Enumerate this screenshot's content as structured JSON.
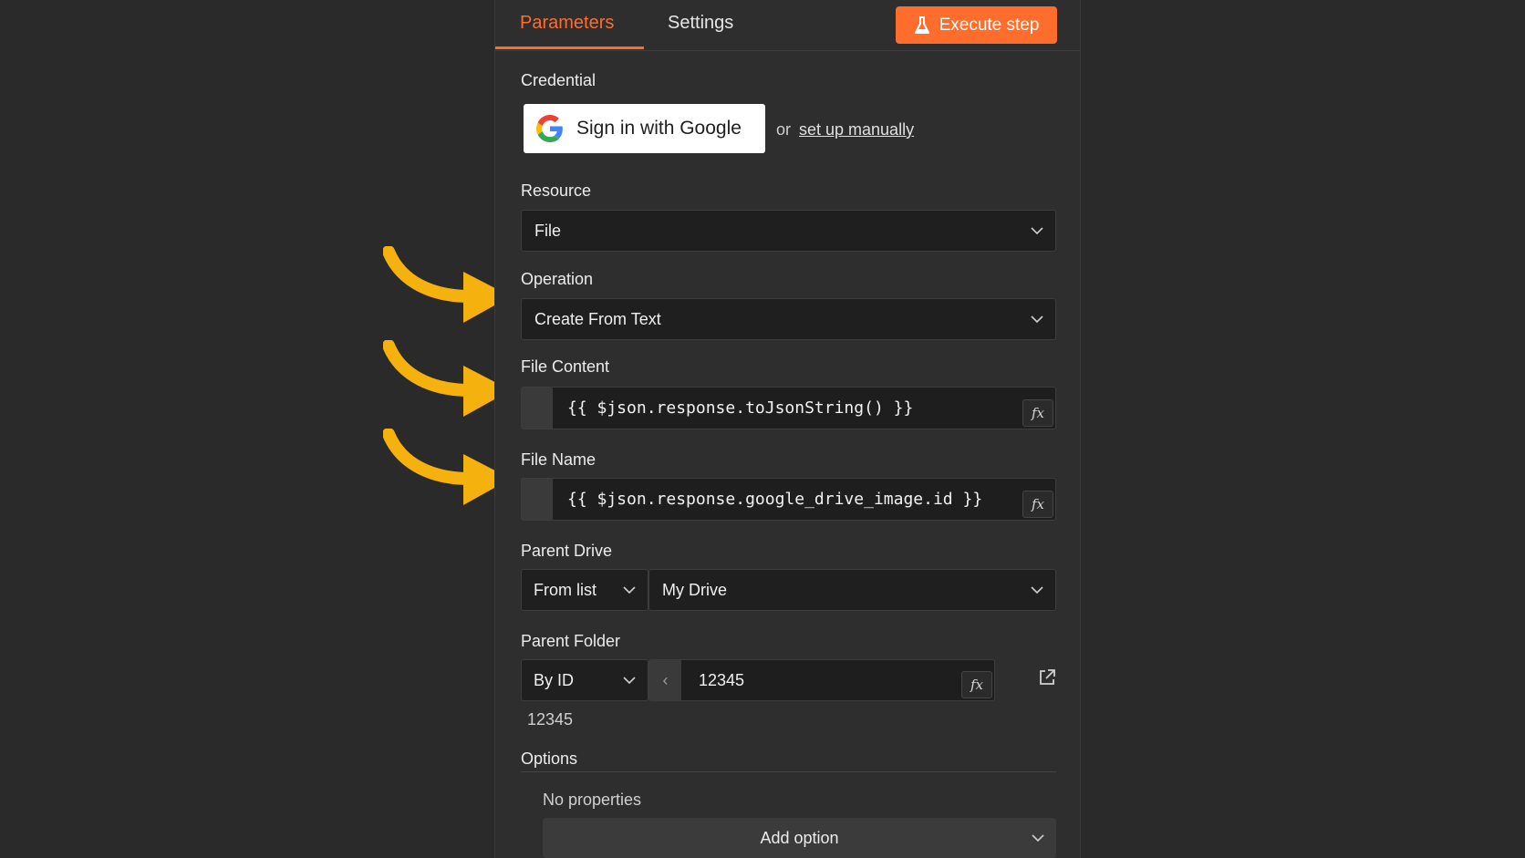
{
  "tabs": [
    {
      "label": "Parameters",
      "active": true
    },
    {
      "label": "Settings",
      "active": false
    }
  ],
  "execute_button": {
    "label": "Execute step",
    "icon": "flask-icon",
    "color": "#ff6d2d"
  },
  "credential": {
    "label": "Credential",
    "google_button_label": "Sign in with Google",
    "or_text": "or",
    "setup_link": "set up manually"
  },
  "resource": {
    "label": "Resource",
    "value": "File"
  },
  "operation": {
    "label": "Operation",
    "value": "Create From Text"
  },
  "file_content": {
    "label": "File Content",
    "value": "{{ $json.response.toJsonString() }}",
    "fx_label": "fx"
  },
  "file_name": {
    "label": "File Name",
    "value": "{{ $json.response.google_drive_image.id }}",
    "fx_label": "fx"
  },
  "parent_drive": {
    "label": "Parent Drive",
    "mode": "From list",
    "value": "My Drive"
  },
  "parent_folder": {
    "label": "Parent Folder",
    "mode": "By ID",
    "value": "12345",
    "fx_label": "fx",
    "hint": "12345"
  },
  "options": {
    "label": "Options",
    "empty_text": "No properties",
    "add_button": "Add option"
  },
  "colors": {
    "accent": "#ff6d2d",
    "arrow": "#f5b10e",
    "background": "#2a2a2a"
  }
}
